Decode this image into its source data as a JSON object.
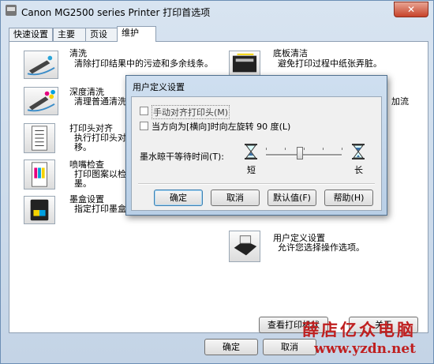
{
  "window": {
    "title": "Canon MG2500 series Printer 打印首选项",
    "close_glyph": "✕"
  },
  "tabs": [
    "快速设置",
    "主要",
    "页设置",
    "维护"
  ],
  "tools_left": [
    {
      "title": "清洗",
      "desc": "清除打印结果中的污迹和多余线条。",
      "icon": "cleaning-icon"
    },
    {
      "title": "深度清洗",
      "desc": "清理普通清洗",
      "icon": "deep-cleaning-icon"
    },
    {
      "title": "打印头对齐",
      "desc": "执行打印头对",
      "desc2": "移。",
      "icon": "print-head-alignment-icon"
    },
    {
      "title": "喷嘴检查",
      "desc": "打印图案以检",
      "desc2": "墨。",
      "icon": "nozzle-check-icon"
    },
    {
      "title": "墨盒设置",
      "desc": "指定打印墨盒",
      "icon": "ink-cartridge-icon"
    }
  ],
  "tools_right": [
    {
      "title": "底板清洁",
      "desc": "避免打印过程中纸张弄脏。",
      "icon": "bottom-plate-cleaning-icon"
    },
    {
      "title": "",
      "desc": "加流",
      "icon": ""
    },
    {
      "title": "用户定义设置",
      "desc": "允许您选择操作选项。",
      "icon": "custom-settings-icon"
    }
  ],
  "bottom_buttons": {
    "view_status": "查看打印机状",
    "about": "关于",
    "ok": "确定",
    "cancel": "取消"
  },
  "dialog": {
    "title": "用户定义设置",
    "checkbox1": "手动对齐打印头(M)",
    "checkbox2": "当方向为[横向]时向左旋转 90 度(L)",
    "slider_label": "墨水晾干等待时间(T):",
    "slider_min": "短",
    "slider_max": "长",
    "slider_value": 0.45,
    "buttons": {
      "ok": "确定",
      "cancel": "取消",
      "default": "默认值(F)",
      "help": "帮助(H)"
    }
  },
  "watermark": {
    "line1": "薛店亿众电脑",
    "line2": "www.yzdn.net"
  }
}
